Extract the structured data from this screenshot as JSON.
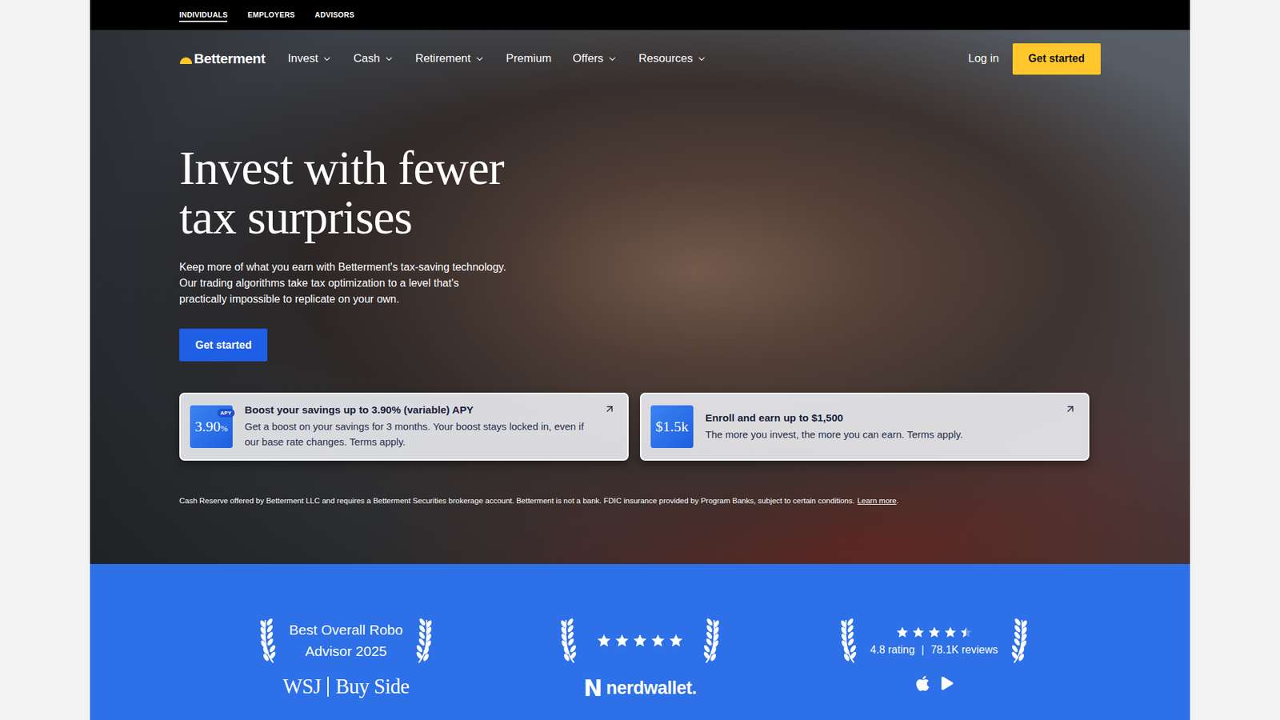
{
  "top_bar": {
    "tabs": [
      {
        "label": "INDIVIDUALS",
        "selected": true
      },
      {
        "label": "EMPLOYERS",
        "selected": false
      },
      {
        "label": "ADVISORS",
        "selected": false
      }
    ]
  },
  "nav": {
    "logo": "Betterment",
    "items": [
      {
        "label": "Invest",
        "dropdown": true
      },
      {
        "label": "Cash",
        "dropdown": true
      },
      {
        "label": "Retirement",
        "dropdown": true
      },
      {
        "label": "Premium",
        "dropdown": false
      },
      {
        "label": "Offers",
        "dropdown": true
      },
      {
        "label": "Resources",
        "dropdown": true
      }
    ],
    "login": "Log in",
    "cta": "Get started"
  },
  "hero": {
    "title_lines": [
      "Invest with fewer",
      "tax surprises"
    ],
    "subtitle_lines": [
      "Keep more of what you earn with Betterment's tax-saving technology.",
      "Our trading algorithms take tax optimization to a level that's",
      "practically impossible to replicate on your own."
    ],
    "cta": "Get started"
  },
  "offers": [
    {
      "badge": "3.90",
      "badge_unit": "%",
      "badge_tag": "APY",
      "title": "Boost your savings up to 3.90% (variable) APY",
      "body": "Get a boost on your savings for 3 months. Your boost stays locked in, even if our base rate changes. Terms apply."
    },
    {
      "badge": "$1.5k",
      "badge_unit": "",
      "badge_tag": "",
      "title": "Enroll and earn up to $1,500",
      "body": "The more you invest, the more you can earn. Terms apply."
    }
  ],
  "disclaimer": {
    "text": "Cash Reserve offered by Betterment LLC and requires a Betterment Securities brokerage account. Betterment is not a bank. FDIC insurance provided by Program Banks, subject to certain conditions.",
    "link": "Learn more",
    "end": "."
  },
  "awards": [
    {
      "kind": "text",
      "title_lines": [
        "Best Overall Robo",
        "Advisor 2025"
      ],
      "source": [
        "WSJ",
        "Buy Side"
      ]
    },
    {
      "kind": "stars",
      "stars": 5,
      "mark": "N",
      "source": [
        "nerdwallet."
      ]
    },
    {
      "kind": "rating",
      "stars": 4.5,
      "rating": "4.8 rating",
      "separator": "|",
      "reviews": "78.1K reviews"
    }
  ]
}
